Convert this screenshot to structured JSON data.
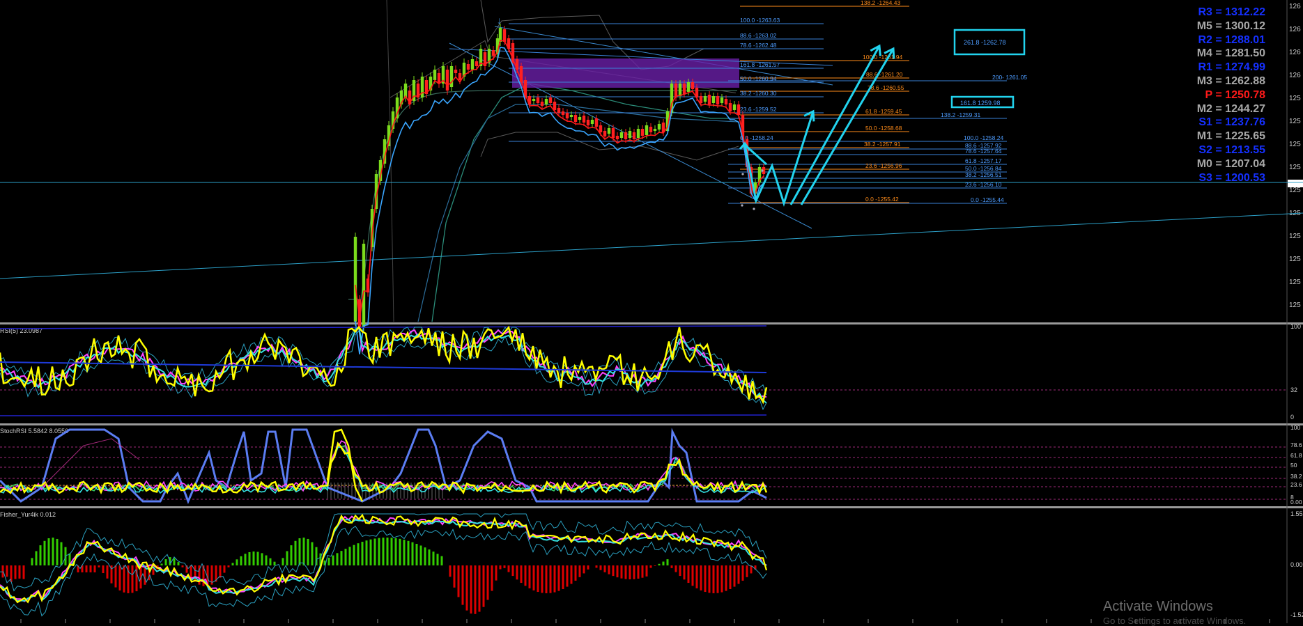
{
  "colors": {
    "background": "#000000",
    "bull_candle": "#7cdc1c",
    "bear_candle": "#ff2020",
    "fib_blue": "#3c8cff",
    "fib_orange": "#ff8c1a",
    "cyan_arrow": "#22d3ee",
    "supply_zone": "#6a1fa8",
    "pivot_blue": "#1530ff",
    "pivot_gray": "#a8a8a8",
    "pivot_red": "#ff1a1a",
    "rsi_yellow": "#ffff00",
    "stoch_blue": "#5b7df2",
    "hist_green": "#33cc00",
    "hist_red": "#dd0000"
  },
  "pivots": [
    {
      "label": "R3 = 1312.22",
      "color": "blue"
    },
    {
      "label": "M5 = 1300.12",
      "color": "gray"
    },
    {
      "label": "R2 = 1288.01",
      "color": "blue"
    },
    {
      "label": "M4 = 1281.50",
      "color": "gray"
    },
    {
      "label": "R1 = 1274.99",
      "color": "blue"
    },
    {
      "label": "M3 = 1262.88",
      "color": "gray"
    },
    {
      "label": "P   = 1250.78",
      "color": "red"
    },
    {
      "label": "M2 = 1244.27",
      "color": "gray"
    },
    {
      "label": "S1 = 1237.76",
      "color": "blue"
    },
    {
      "label": "M1 = 1225.65",
      "color": "gray"
    },
    {
      "label": "S2 = 1213.55",
      "color": "blue"
    },
    {
      "label": "M0 = 1207.04",
      "color": "gray"
    },
    {
      "label": "S3 = 1200.53",
      "color": "blue"
    }
  ],
  "fib_left": [
    {
      "label": "100.0 -1263.63",
      "color": "blue"
    },
    {
      "label": "88.6 -1263.02",
      "color": "blue"
    },
    {
      "label": "78.6 -1262.48",
      "color": "blue"
    },
    {
      "label": "161.8 -1261.57",
      "color": "blue"
    },
    {
      "label": "50.0 -1260.94",
      "color": "blue"
    },
    {
      "label": "38.2 -1260.30",
      "color": "blue"
    },
    {
      "label": "23.6 -1259.52",
      "color": "blue"
    },
    {
      "label": "0.0 -1258.24",
      "color": "blue"
    }
  ],
  "fib_mid": [
    {
      "label": "138.2 -1264.43",
      "color": "orange"
    },
    {
      "label": "100.0 -1261.94",
      "color": "orange"
    },
    {
      "label": "88.6 -1261.20",
      "color": "orange"
    },
    {
      "label": "78.6 -1260.55",
      "color": "orange"
    },
    {
      "label": "61.8 -1259.45",
      "color": "orange"
    },
    {
      "label": "50.0 -1258.68",
      "color": "orange"
    },
    {
      "label": "38.2 -1257.91",
      "color": "orange"
    },
    {
      "label": "23.6 -1256.96",
      "color": "orange"
    },
    {
      "label": "0.0 -1255.42",
      "color": "orange"
    }
  ],
  "fib_right": [
    {
      "label": "200- 1261.05",
      "color": "blue"
    },
    {
      "label": "138.2 -1259.31",
      "color": "blue"
    },
    {
      "label": "100.0 -1258.24",
      "color": "blue"
    },
    {
      "label": "88.6 -1257.92",
      "color": "blue"
    },
    {
      "label": "78.6 -1257.64",
      "color": "blue"
    },
    {
      "label": "61.8 -1257.17",
      "color": "blue"
    },
    {
      "label": "50.0 -1256.84",
      "color": "blue"
    },
    {
      "label": "38.2 -1256.51",
      "color": "blue"
    },
    {
      "label": "23.6 -1256.10",
      "color": "blue"
    },
    {
      "label": "0.0 -1255.44",
      "color": "blue"
    }
  ],
  "boxed_labels": [
    {
      "label": "261.8 -1262.78"
    },
    {
      "label": "161.8 1259.98"
    }
  ],
  "price_axis": [
    "126",
    "126",
    "126",
    "126",
    "125",
    "125",
    "125",
    "125",
    "125",
    "125",
    "125",
    "125",
    "125",
    "125"
  ],
  "rsi": {
    "title": "RSI(5) 23.0987",
    "axis": [
      "100",
      "32",
      "0"
    ]
  },
  "stoch": {
    "title": "StochRSI 5.5842 8.0550",
    "axis": [
      "100",
      "78.6",
      "61.8",
      "50",
      "38.2",
      "23.6",
      "8",
      "0.00"
    ]
  },
  "fisher": {
    "title": "Fisher_Yur4ik 0.012",
    "axis": [
      "1.55",
      "0.00",
      "-1.52"
    ]
  },
  "watermark": {
    "line1": "Activate Windows",
    "line2": "Go to Settings to activate Windows."
  }
}
